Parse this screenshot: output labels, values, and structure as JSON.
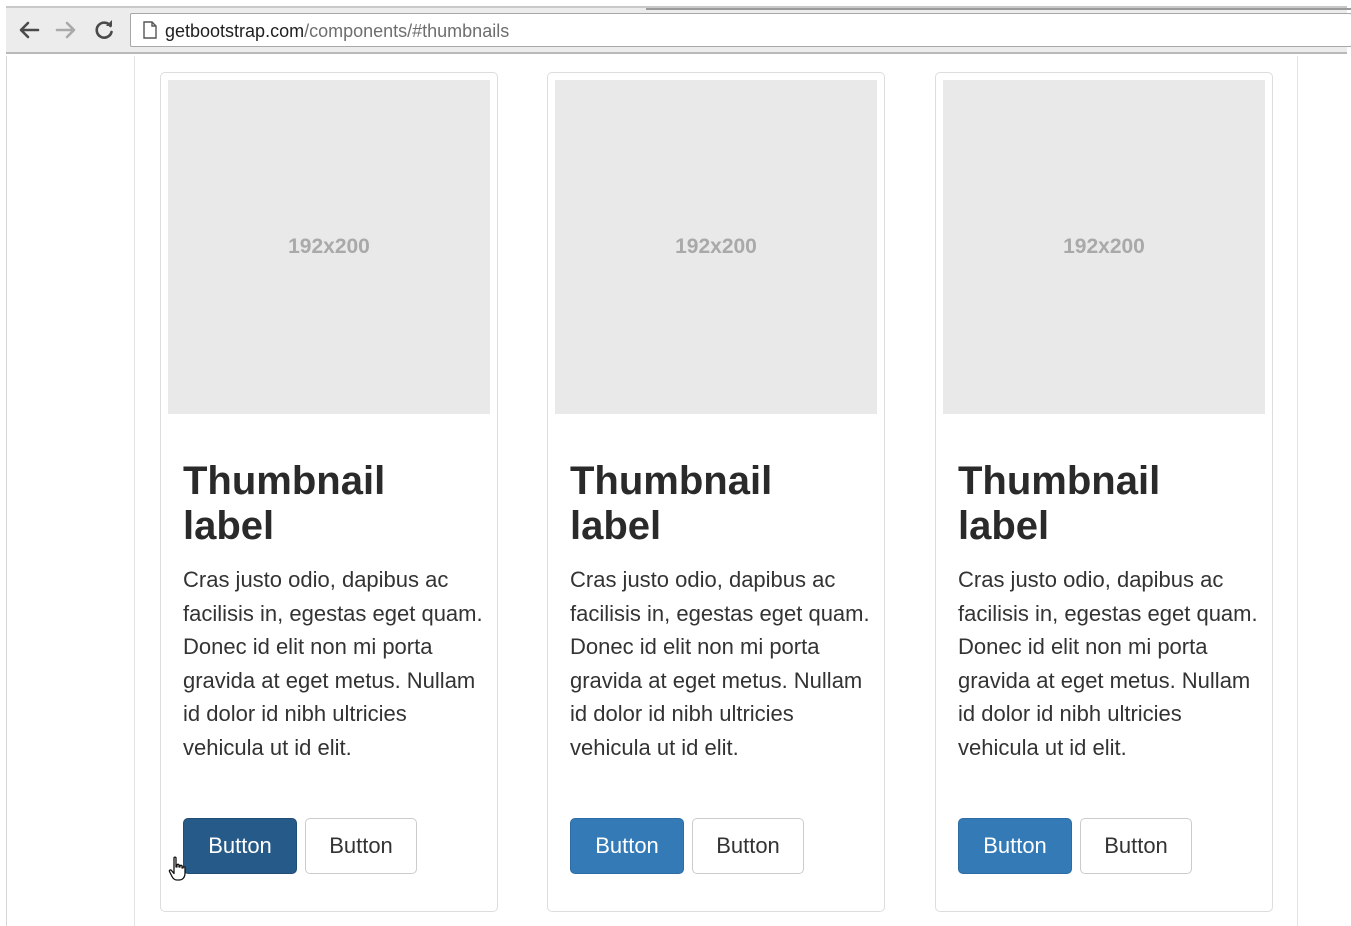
{
  "browser": {
    "url_host": "getbootstrap.com",
    "url_path": "/components/#thumbnails",
    "back_icon": "arrow-left-icon",
    "forward_icon": "arrow-right-icon",
    "reload_icon": "reload-icon",
    "page_icon": "document-icon"
  },
  "thumbnails": [
    {
      "placeholder": "192x200",
      "title": "Thumbnail label",
      "text": "Cras justo odio, dapibus ac facilisis in, egestas eget quam. Donec id elit non mi porta gravida at eget metus. Nullam id dolor id nibh ultricies vehicula ut id elit.",
      "primary_button": "Button",
      "default_button": "Button"
    },
    {
      "placeholder": "192x200",
      "title": "Thumbnail label",
      "text": "Cras justo odio, dapibus ac facilisis in, egestas eget quam. Donec id elit non mi porta gravida at eget metus. Nullam id dolor id nibh ultricies vehicula ut id elit.",
      "primary_button": "Button",
      "default_button": "Button"
    },
    {
      "placeholder": "192x200",
      "title": "Thumbnail label",
      "text": "Cras justo odio, dapibus ac facilisis in, egestas eget quam. Donec id elit non mi porta gravida at eget metus. Nullam id dolor id nibh ultricies vehicula ut id elit.",
      "primary_button": "Button",
      "default_button": "Button"
    }
  ],
  "colors": {
    "primary": "#337ab7",
    "primary_active": "#265a88",
    "placeholder_bg": "#e9e9ea",
    "thumbnail_border": "#dddddd"
  }
}
